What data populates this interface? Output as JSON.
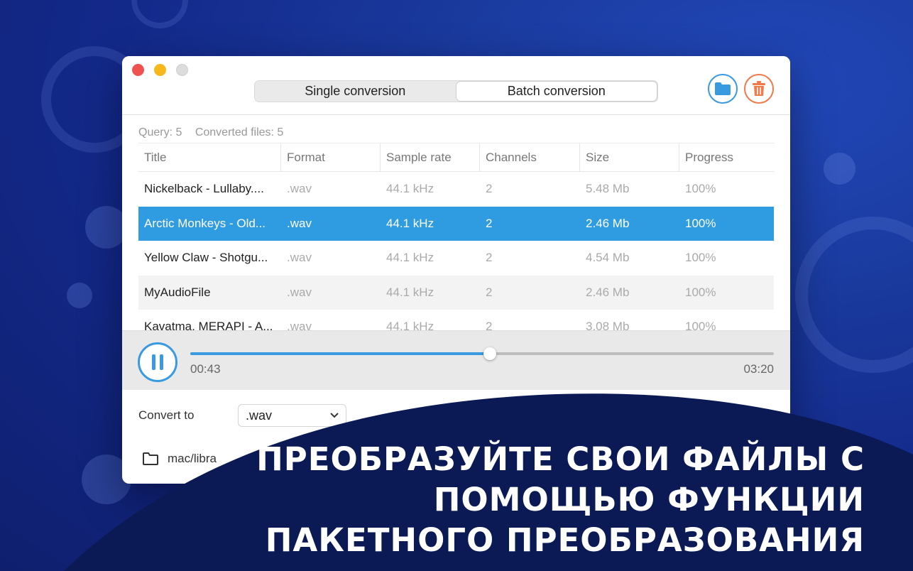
{
  "tabs": [
    {
      "label": "Single conversion",
      "active": false
    },
    {
      "label": "Batch conversion",
      "active": true
    }
  ],
  "toolbar": {
    "folder_icon": "folder-icon",
    "trash_icon": "trash-icon"
  },
  "stats": {
    "query": "Query: 5",
    "converted": "Converted files: 5"
  },
  "table": {
    "columns": [
      "Title",
      "Format",
      "Sample rate",
      "Channels",
      "Size",
      "Progress"
    ],
    "rows": [
      [
        "Nickelback - Lullaby....",
        ".wav",
        "44.1 kHz",
        "2",
        "5.48 Mb",
        "100%"
      ],
      [
        "Arctic Monkeys - Old...",
        ".wav",
        "44.1 kHz",
        "2",
        "2.46 Mb",
        "100%"
      ],
      [
        "Yellow Claw - Shotgu...",
        ".wav",
        "44.1 kHz",
        "2",
        "4.54 Mb",
        "100%"
      ],
      [
        "MyAudioFile",
        ".wav",
        "44.1 kHz",
        "2",
        "2.46 Mb",
        "100%"
      ],
      [
        "Kavatma, MERAPI - A...",
        ".wav",
        "44.1 kHz",
        "2",
        "3.08 Mb",
        "100%"
      ]
    ],
    "selected_row": 1
  },
  "player": {
    "current_time": "00:43",
    "total_time": "03:20",
    "progress": 0.513
  },
  "convert": {
    "label": "Convert to",
    "format": ".wav"
  },
  "output": {
    "path": "mac/libra"
  },
  "headline": "ПРЕОБРАЗУЙТЕ СВОИ ФАЙЛЫ С ПОМОЩЬЮ ФУНКЦИИ ПАКЕТНОГО ПРЕОБРАЗОВАНИЯ",
  "colors": {
    "accent": "#2f9be0",
    "danger": "#f07a4a",
    "banner": "#0b1a55"
  }
}
